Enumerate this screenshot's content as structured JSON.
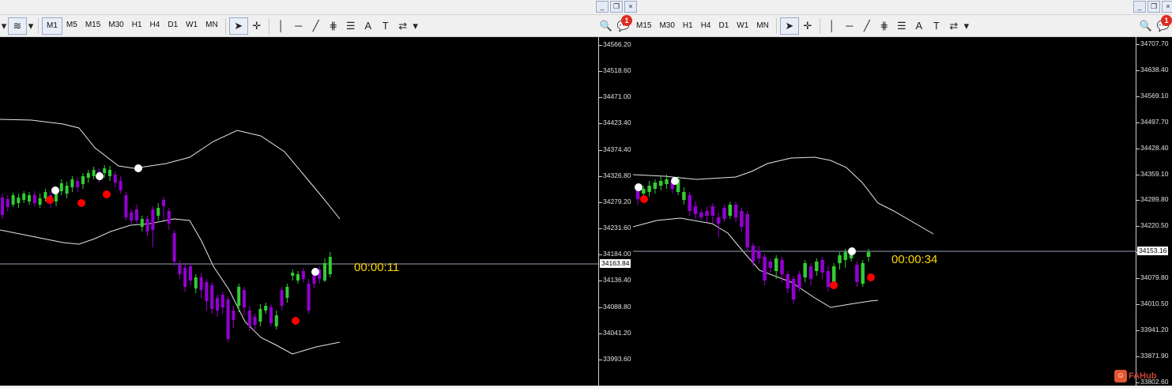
{
  "left_window": {
    "timeframes": [
      "M1",
      "M5",
      "M15",
      "M30",
      "H1",
      "H4",
      "D1",
      "W1",
      "MN"
    ],
    "active_timeframe": "M1",
    "notification_count": "1",
    "price_labels": [
      "34566.20",
      "34518.60",
      "34471.00",
      "34423.40",
      "34374.40",
      "34326.80",
      "34279.20",
      "34231.60",
      "34184.00",
      "34136.40",
      "34088.80",
      "34041.20",
      "33993.60"
    ],
    "current_price": "34163.84",
    "countdown": "00:00:11"
  },
  "right_window": {
    "timeframes": [
      "M15",
      "M30",
      "H1",
      "H4",
      "D1",
      "W1",
      "MN"
    ],
    "notification_count": "1",
    "price_labels": [
      "34707.70",
      "34638.40",
      "34569.10",
      "34497.70",
      "34428.40",
      "34359.10",
      "34289.80",
      "34220.50",
      "34151.20",
      "34079.80",
      "34010.50",
      "33941.20",
      "33871.90",
      "33802.60"
    ],
    "current_price": "34153.16",
    "countdown": "00:00:34"
  },
  "watermark": "FAHub",
  "colors": {
    "bull_candle": "#32cd32",
    "bear_candle": "#9400d3",
    "band": "#e6e6e6",
    "marker_high": "#ffffff",
    "marker_low": "#ff0000",
    "countdown": "#ffd700"
  }
}
